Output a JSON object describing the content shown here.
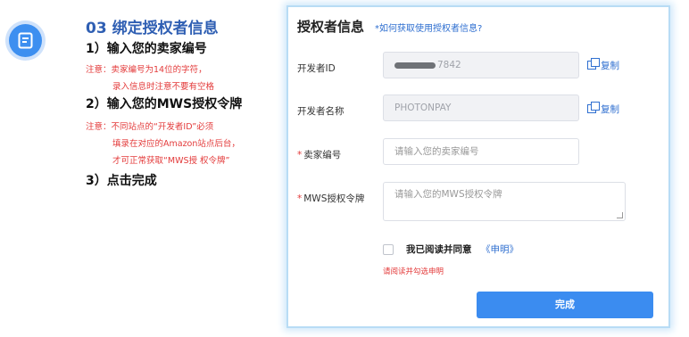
{
  "instructions": {
    "title": "03 绑定授权者信息",
    "step1": "1）输入您的卖家编号",
    "step1_note_line1": "注意：卖家编号为14位的字符，",
    "step1_note_line2": "录入信息时注意不要有空格",
    "step2": "2）输入您的MWS授权令牌",
    "step2_note_line1": "注意：不同站点的“开发者ID”必须",
    "step2_note_line2": "填录在对应的Amazon站点后台，",
    "step2_note_line3": "才可正常获取“MWS授 权令牌”",
    "step3": "3）点击完成"
  },
  "form": {
    "title": "授权者信息",
    "help_link": "*如何获取使用授权者信息?",
    "developer_id_label": "开发者ID",
    "developer_id_value": "7842",
    "developer_name_label": "开发者名称",
    "developer_name_value": "PHOTONPAY",
    "copy_label": "复制",
    "seller_id_label": "卖家编号",
    "seller_id_placeholder": "请输入您的卖家编号",
    "mws_token_label": "MWS授权令牌",
    "mws_token_placeholder": "请输入您的MWS授权令牌",
    "agree_text": "我已阅读并同意",
    "agree_link": "《申明》",
    "error_text": "请阅读并勾选申明",
    "submit_label": "完成",
    "required_mark": "*"
  },
  "colors": {
    "accent": "#3b8cf0",
    "title": "#2f5fb3",
    "error": "#e33a3a",
    "link": "#2f6fd0"
  }
}
